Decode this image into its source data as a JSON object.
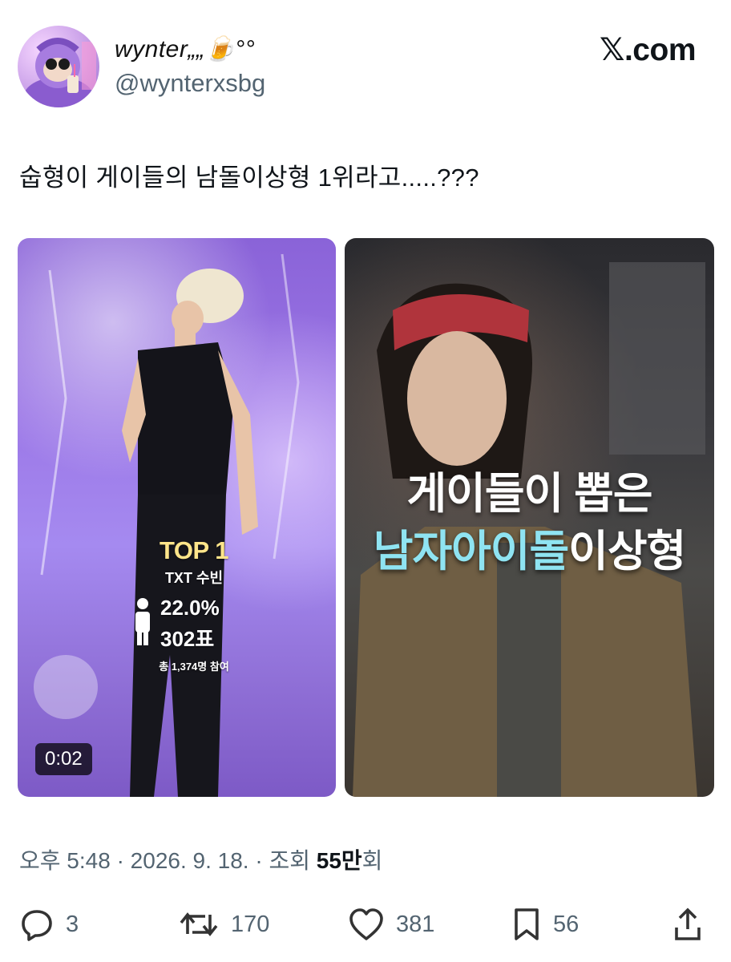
{
  "author": {
    "display_name": "wynter„„🍺°°",
    "handle": "@wynterxsbg"
  },
  "brand": {
    "label": ".com",
    "mark": "𝕏"
  },
  "tweet": {
    "text": "숩형이 게이들의 남돌이상형 1위라고.....???"
  },
  "media": {
    "left": {
      "rank_label": "TOP 1",
      "subject": "TXT 수빈",
      "percent": "22.0%",
      "votes": "302표",
      "participants": "총 1,374명 참여",
      "duration": "0:02"
    },
    "right": {
      "line1": "게이들이 뽑은",
      "line2_a": "남자아이돌",
      "line2_b": "이상형"
    }
  },
  "meta": {
    "time": "오후 5:48 · 2026. 9. 18. · 조회 ",
    "views": "55만",
    "views_suffix": "회"
  },
  "actions": {
    "replies": "3",
    "reposts": "170",
    "likes": "381",
    "bookmarks": "56"
  },
  "colors": {
    "text_primary": "#0f1419",
    "text_secondary": "#536471",
    "accent_gold": "#ffe58a",
    "accent_cyan": "#8fe4f2"
  }
}
